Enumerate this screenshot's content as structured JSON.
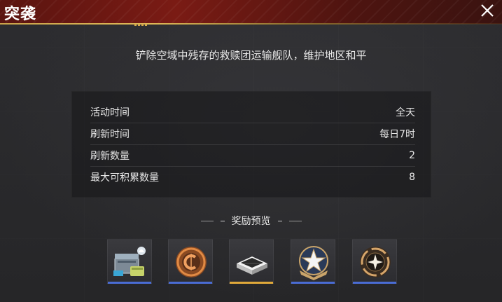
{
  "header": {
    "title": "突袭"
  },
  "description": "铲除空域中残存的救赎团运输舰队，维护地区和平",
  "info": [
    {
      "label": "活动时间",
      "value": "全天"
    },
    {
      "label": "刷新时间",
      "value": "每日7时"
    },
    {
      "label": "刷新数量",
      "value": "2"
    },
    {
      "label": "最大可积累数量",
      "value": "8"
    }
  ],
  "rewards": {
    "title": "奖励预览",
    "items": [
      {
        "icon": "supply-crate-icon",
        "rarity_color": "#4a6cd4"
      },
      {
        "icon": "credit-coin-icon",
        "rarity_color": "#4a6cd4"
      },
      {
        "icon": "blueprint-box-icon",
        "rarity_color": "#e0a93a"
      },
      {
        "icon": "rank-wings-star-icon",
        "rarity_color": "#4a6cd4"
      },
      {
        "icon": "star-medal-icon",
        "rarity_color": "#4a6cd4"
      }
    ]
  },
  "colors": {
    "header_red": "#7a1b14",
    "gold_accent": "#e0b857",
    "rare_blue": "#4a6cd4"
  }
}
